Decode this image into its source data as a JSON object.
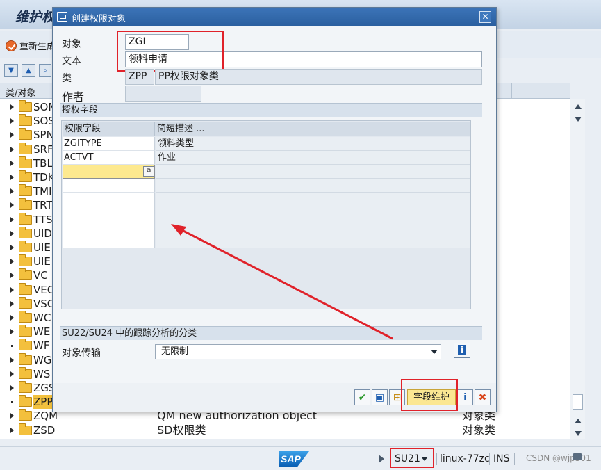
{
  "background": {
    "window_title": "维护权",
    "regen_label": "重新生成",
    "tree_header": "类/对象",
    "rows": [
      {
        "name": "SOM",
        "desc": "",
        "kind": "",
        "marker": "arrow"
      },
      {
        "name": "SOS",
        "desc": "",
        "kind": "",
        "marker": "arrow"
      },
      {
        "name": "SPN",
        "desc": "",
        "kind": "",
        "marker": "arrow"
      },
      {
        "name": "SRF",
        "desc": "",
        "kind": "",
        "marker": "arrow"
      },
      {
        "name": "TBL",
        "desc": "",
        "kind": "",
        "marker": "arrow"
      },
      {
        "name": "TDK",
        "desc": "",
        "kind": "",
        "marker": "arrow"
      },
      {
        "name": "TMI",
        "desc": "",
        "kind": "",
        "marker": "arrow"
      },
      {
        "name": "TRT",
        "desc": "",
        "kind": "",
        "marker": "arrow"
      },
      {
        "name": "TTS",
        "desc": "",
        "kind": "",
        "marker": "arrow"
      },
      {
        "name": "UID",
        "desc": "",
        "kind": "",
        "marker": "arrow"
      },
      {
        "name": "UIE",
        "desc": "",
        "kind": "",
        "marker": "arrow"
      },
      {
        "name": "UIE",
        "desc": "",
        "kind": "",
        "marker": "arrow"
      },
      {
        "name": "VC",
        "desc": "",
        "kind": "",
        "marker": "arrow"
      },
      {
        "name": "VEC",
        "desc": "",
        "kind": "",
        "marker": "arrow"
      },
      {
        "name": "VSC",
        "desc": "",
        "kind": "",
        "marker": "arrow"
      },
      {
        "name": "WC",
        "desc": "",
        "kind": "",
        "marker": "arrow"
      },
      {
        "name": "WE",
        "desc": "",
        "kind": "",
        "marker": "arrow"
      },
      {
        "name": "WF",
        "desc": "",
        "kind": "",
        "marker": "dot"
      },
      {
        "name": "WG",
        "desc": "",
        "kind": "",
        "marker": "arrow"
      },
      {
        "name": "WS",
        "desc": "",
        "kind": "",
        "marker": "arrow"
      },
      {
        "name": "ZGS",
        "desc": "",
        "kind": "",
        "marker": "arrow"
      },
      {
        "name": "ZPP",
        "desc": "",
        "kind": "",
        "marker": "dot",
        "selected": true
      },
      {
        "name": "ZQM",
        "desc": "QM new authorization object",
        "kind": "对象类",
        "marker": "arrow"
      },
      {
        "name": "ZSD",
        "desc": "SD权限类",
        "kind": "对象类",
        "marker": "arrow"
      }
    ]
  },
  "dialog": {
    "title": "创建权限对象",
    "close_glyph": "✕",
    "labels": {
      "object": "对象",
      "text": "文本",
      "class": "类",
      "author": "作者"
    },
    "values": {
      "object": "ZGI",
      "text": "领料申请",
      "class_code": "ZPP",
      "class_desc": "PP权限对象类",
      "author": ""
    },
    "auth_fields_group": "授权字段",
    "grid_headers": [
      "权限字段",
      "简短描述 ..."
    ],
    "grid_rows": [
      {
        "field": "ZGITYPE",
        "desc": "领料类型"
      },
      {
        "field": "ACTVT",
        "desc": "作业"
      }
    ],
    "su24_group": "SU22/SU24 中的跟踪分析的分类",
    "transport_label": "对象传输",
    "transport_value": "无限制",
    "footer": {
      "field_maint_label": "字段维护"
    }
  },
  "status": {
    "sap_logo": "SAP",
    "tcode": "SU21",
    "host": "linux-77zc",
    "mode": "INS",
    "watermark": "CSDN @wjp501"
  },
  "colors": {
    "annotation_red": "#e0222a",
    "title_blue": "#2a5f9f",
    "highlight_yellow": "#fbe792"
  }
}
